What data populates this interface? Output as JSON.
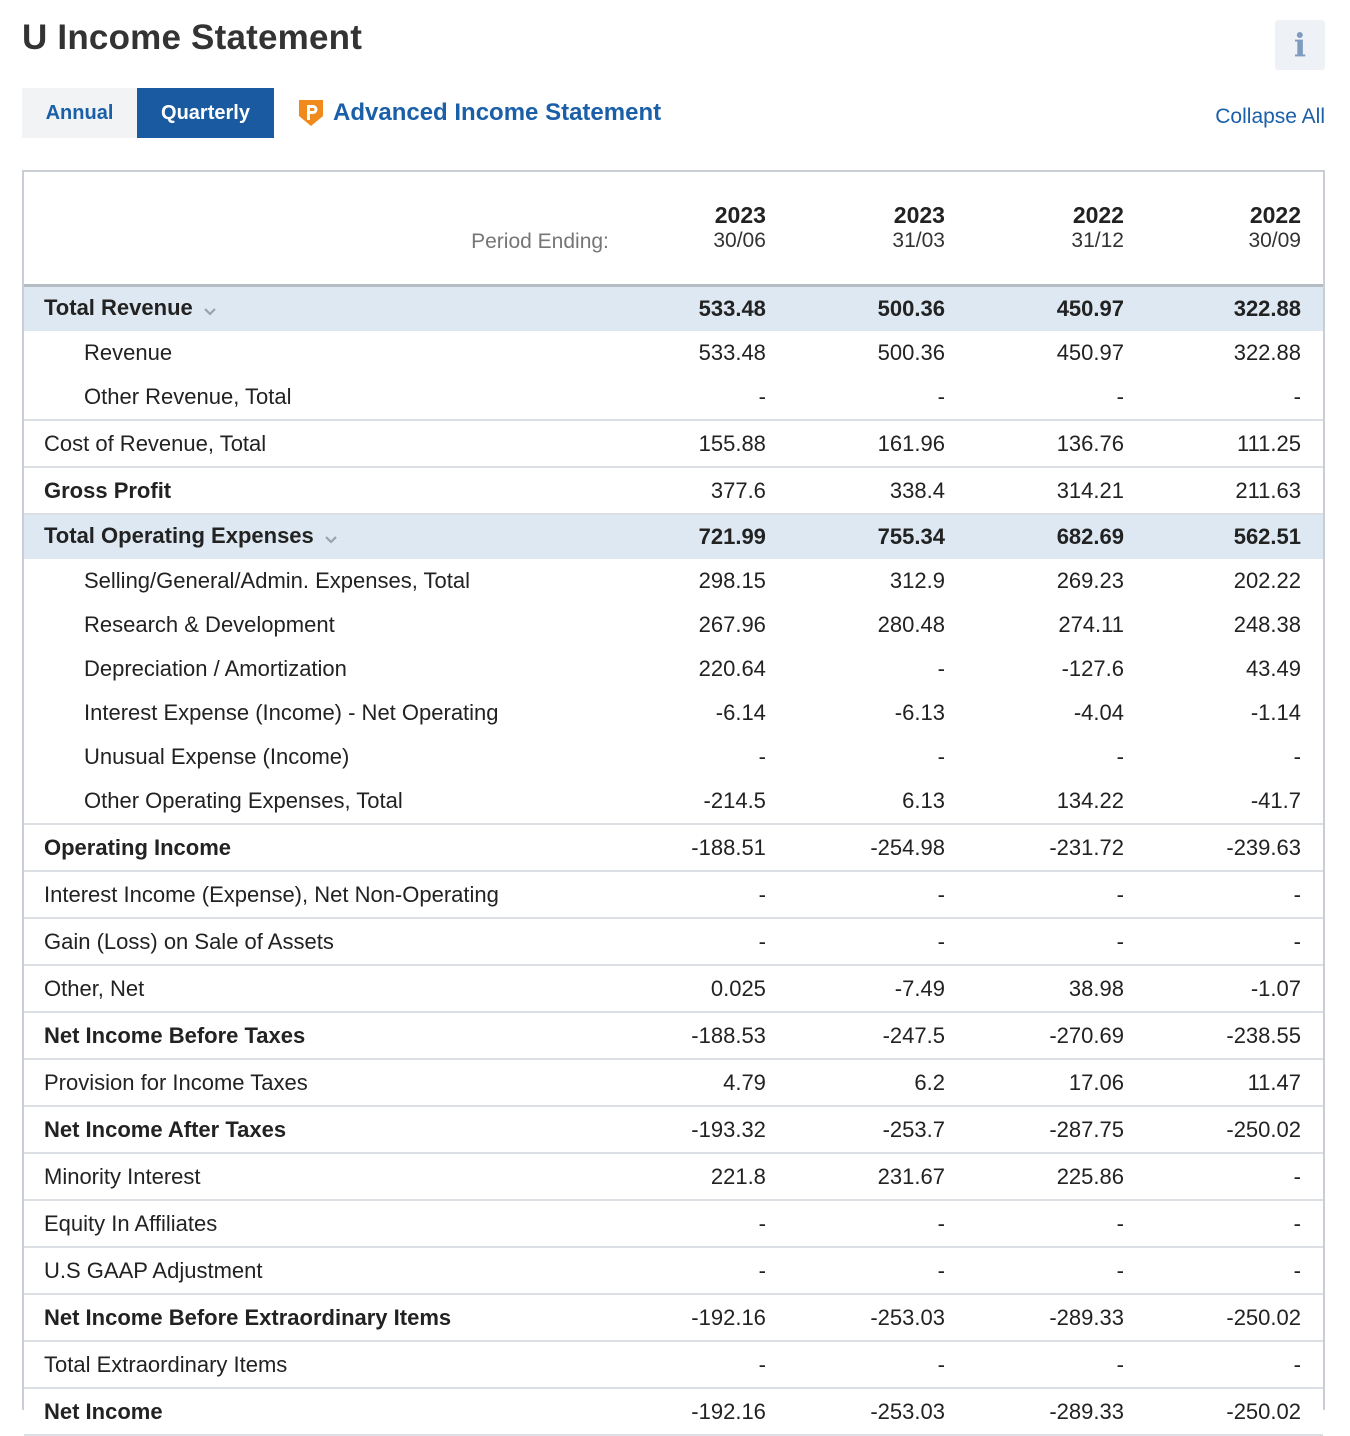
{
  "page": {
    "title": "U Income Statement",
    "info_icon": "i",
    "tabs": [
      {
        "label": "Annual",
        "active": false
      },
      {
        "label": "Quarterly",
        "active": true
      }
    ],
    "advanced_link": "Advanced Income Statement",
    "collapse_all": "Collapse All"
  },
  "table": {
    "period_label": "Period Ending:",
    "columns": [
      {
        "year": "2023",
        "date": "30/06"
      },
      {
        "year": "2023",
        "date": "31/03"
      },
      {
        "year": "2022",
        "date": "31/12"
      },
      {
        "year": "2022",
        "date": "30/09"
      }
    ],
    "rows": [
      {
        "label": "Total Revenue",
        "values": [
          "533.48",
          "500.36",
          "450.97",
          "322.88"
        ]
      },
      {
        "label": "Revenue",
        "values": [
          "533.48",
          "500.36",
          "450.97",
          "322.88"
        ]
      },
      {
        "label": "Other Revenue, Total",
        "values": [
          "-",
          "-",
          "-",
          "-"
        ]
      },
      {
        "label": "Cost of Revenue, Total",
        "values": [
          "155.88",
          "161.96",
          "136.76",
          "111.25"
        ]
      },
      {
        "label": "Gross Profit",
        "values": [
          "377.6",
          "338.4",
          "314.21",
          "211.63"
        ]
      },
      {
        "label": "Total Operating Expenses",
        "values": [
          "721.99",
          "755.34",
          "682.69",
          "562.51"
        ]
      },
      {
        "label": "Selling/General/Admin. Expenses, Total",
        "values": [
          "298.15",
          "312.9",
          "269.23",
          "202.22"
        ]
      },
      {
        "label": "Research & Development",
        "values": [
          "267.96",
          "280.48",
          "274.11",
          "248.38"
        ]
      },
      {
        "label": "Depreciation / Amortization",
        "values": [
          "220.64",
          "-",
          "-127.6",
          "43.49"
        ]
      },
      {
        "label": "Interest Expense (Income) - Net Operating",
        "values": [
          "-6.14",
          "-6.13",
          "-4.04",
          "-1.14"
        ]
      },
      {
        "label": "Unusual Expense (Income)",
        "values": [
          "-",
          "-",
          "-",
          "-"
        ]
      },
      {
        "label": "Other Operating Expenses, Total",
        "values": [
          "-214.5",
          "6.13",
          "134.22",
          "-41.7"
        ]
      },
      {
        "label": "Operating Income",
        "values": [
          "-188.51",
          "-254.98",
          "-231.72",
          "-239.63"
        ]
      },
      {
        "label": "Interest Income (Expense), Net Non-Operating",
        "values": [
          "-",
          "-",
          "-",
          "-"
        ]
      },
      {
        "label": "Gain (Loss) on Sale of Assets",
        "values": [
          "-",
          "-",
          "-",
          "-"
        ]
      },
      {
        "label": "Other, Net",
        "values": [
          "0.025",
          "-7.49",
          "38.98",
          "-1.07"
        ]
      },
      {
        "label": "Net Income Before Taxes",
        "values": [
          "-188.53",
          "-247.5",
          "-270.69",
          "-238.55"
        ]
      },
      {
        "label": "Provision for Income Taxes",
        "values": [
          "4.79",
          "6.2",
          "17.06",
          "11.47"
        ]
      },
      {
        "label": "Net Income After Taxes",
        "values": [
          "-193.32",
          "-253.7",
          "-287.75",
          "-250.02"
        ]
      },
      {
        "label": "Minority Interest",
        "values": [
          "221.8",
          "231.67",
          "225.86",
          "-"
        ]
      },
      {
        "label": "Equity In Affiliates",
        "values": [
          "-",
          "-",
          "-",
          "-"
        ]
      },
      {
        "label": "U.S GAAP Adjustment",
        "values": [
          "-",
          "-",
          "-",
          "-"
        ]
      },
      {
        "label": "Net Income Before Extraordinary Items",
        "values": [
          "-192.16",
          "-253.03",
          "-289.33",
          "-250.02"
        ]
      },
      {
        "label": "Total Extraordinary Items",
        "values": [
          "-",
          "-",
          "-",
          "-"
        ]
      },
      {
        "label": "Net Income",
        "values": [
          "-192.16",
          "-253.03",
          "-289.33",
          "-250.02"
        ]
      }
    ]
  },
  "colors": {
    "accent": "#1a5aa0",
    "link": "#1a5fa8",
    "group_row_bg": "#dde8f2",
    "premium_icon": "#f08a1c"
  }
}
